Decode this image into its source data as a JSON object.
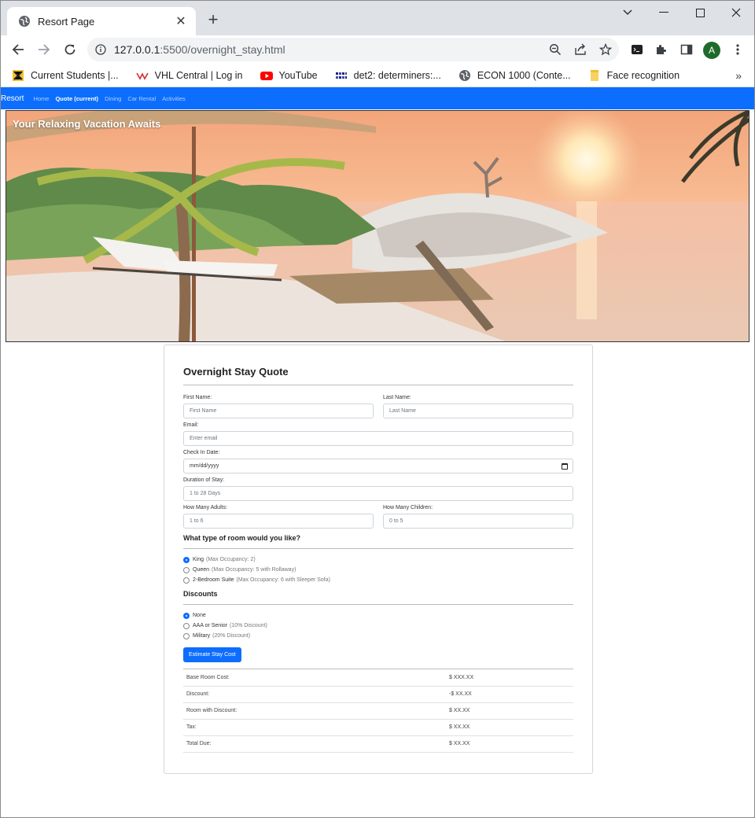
{
  "browser": {
    "tab_title": "Resort Page",
    "url_host": "127.0.0.1",
    "url_rest": ":5500/overnight_stay.html",
    "avatar_letter": "A",
    "bookmarks": [
      {
        "label": "Current Students |...",
        "icon": "school-icon"
      },
      {
        "label": "VHL Central | Log in",
        "icon": "vhl-icon"
      },
      {
        "label": "YouTube",
        "icon": "youtube-icon"
      },
      {
        "label": "det2: determiners:...",
        "icon": "grid-icon"
      },
      {
        "label": "ECON 1000 (Conte...",
        "icon": "globe-icon"
      },
      {
        "label": "Face recognition",
        "icon": "folder-icon"
      }
    ]
  },
  "site": {
    "brand": "Resort",
    "nav": [
      {
        "label": "Home",
        "active": false
      },
      {
        "label": "Quote (current)",
        "active": true
      },
      {
        "label": "Dining",
        "active": false
      },
      {
        "label": "Car Rental",
        "active": false
      },
      {
        "label": "Activities",
        "active": false
      }
    ],
    "hero_title": "Your Relaxing Vacation Awaits"
  },
  "form": {
    "title": "Overnight Stay Quote",
    "first_name_label": "First Name:",
    "first_name_placeholder": "First Name",
    "last_name_label": "Last Name:",
    "last_name_placeholder": "Last Name",
    "email_label": "Email:",
    "email_placeholder": "Enter email",
    "checkin_label": "Check In Date:",
    "checkin_placeholder": "mm/dd/yyyy",
    "duration_label": "Duration of Stay:",
    "duration_placeholder": "1 to 28 Days",
    "adults_label": "How Many Adults:",
    "adults_placeholder": "1 to 6",
    "children_label": "How Many Children:",
    "children_placeholder": "0 to 5",
    "room_title": "What type of room would you like?",
    "rooms": [
      {
        "label": "King",
        "note": "(Max Occupancy: 2)",
        "selected": true
      },
      {
        "label": "Queen",
        "note": "(Max Occupancy: 5 with Rollaway)",
        "selected": false
      },
      {
        "label": "2-Bedroom Suite",
        "note": "(Max Occupancy: 6 with Sleeper Sofa)",
        "selected": false
      }
    ],
    "discount_title": "Discounts",
    "discounts": [
      {
        "label": "None",
        "note": "",
        "selected": true
      },
      {
        "label": "AAA or Senior",
        "note": "(10% Discount)",
        "selected": false
      },
      {
        "label": "Military",
        "note": "(20% Discount)",
        "selected": false
      }
    ],
    "button_label": "Estimate Stay Cost",
    "costs": [
      {
        "label": "Base Room Cost:",
        "value": "$ XXX.XX"
      },
      {
        "label": "Discount:",
        "value": "-$ XX.XX"
      },
      {
        "label": "Room with Discount:",
        "value": "$ XX.XX"
      },
      {
        "label": "Tax:",
        "value": "$ XX.XX"
      },
      {
        "label": "Total Due:",
        "value": "$ XX.XX"
      }
    ]
  },
  "colors": {
    "primary": "#0d6efd",
    "tabstrip": "#dee1e6"
  }
}
